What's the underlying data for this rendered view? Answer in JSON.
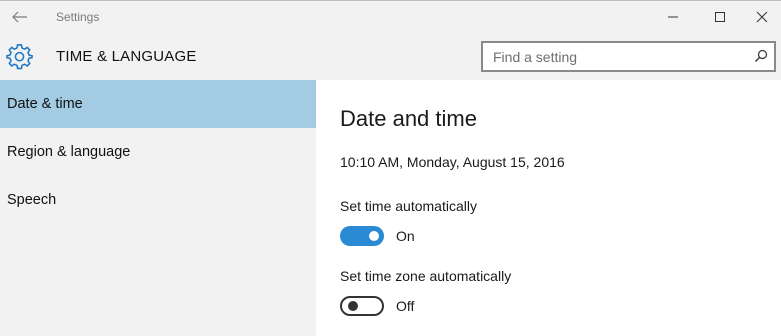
{
  "window": {
    "title": "Settings",
    "back_icon": "back-arrow-icon",
    "minimize_icon": "minimize-icon",
    "maximize_icon": "maximize-icon",
    "close_icon": "close-icon"
  },
  "header": {
    "icon": "gear-icon",
    "title": "TIME & LANGUAGE",
    "search": {
      "placeholder": "Find a setting",
      "value": "",
      "icon": "search-icon"
    }
  },
  "sidebar": {
    "items": [
      {
        "label": "Date & time",
        "selected": true
      },
      {
        "label": "Region & language",
        "selected": false
      },
      {
        "label": "Speech",
        "selected": false
      }
    ],
    "selected_color": "#a3cbe3"
  },
  "main": {
    "title": "Date and time",
    "current_datetime": "10:10 AM, Monday, August 15, 2016",
    "settings": [
      {
        "label": "Set time automatically",
        "state": "On",
        "on": true
      },
      {
        "label": "Set time zone automatically",
        "state": "Off",
        "on": false
      }
    ],
    "accent_color": "#2a8ad4"
  }
}
